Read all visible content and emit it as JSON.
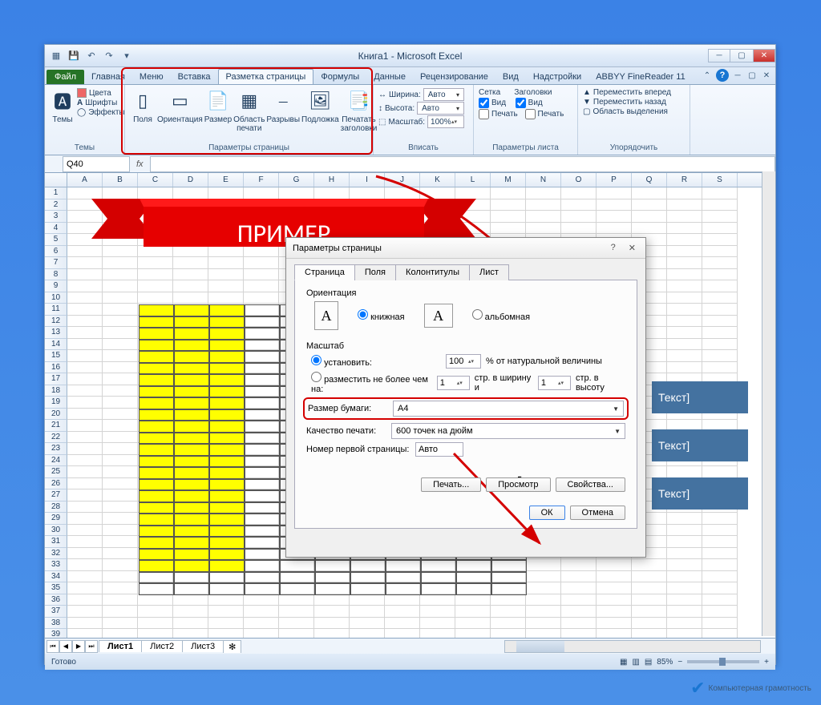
{
  "title": "Книга1 - Microsoft Excel",
  "file_tab": "Файл",
  "tabs": [
    "Главная",
    "Меню",
    "Вставка",
    "Разметка страницы",
    "Формулы",
    "Данные",
    "Рецензирование",
    "Вид",
    "Надстройки",
    "ABBYY FineReader 11"
  ],
  "active_tab": 3,
  "ribbon": {
    "themes": {
      "label": "Темы",
      "btn": "Темы",
      "colors": "Цвета",
      "fonts": "Шрифты",
      "effects": "Эффекты"
    },
    "page": {
      "label": "Параметры страницы",
      "margins": "Поля",
      "orient": "Ориентация",
      "size": "Размер",
      "area": "Область печати",
      "breaks": "Разрывы",
      "bg": "Подложка",
      "titles": "Печатать заголовки"
    },
    "fit": {
      "label": "Вписать",
      "width": "Ширина:",
      "height": "Высота:",
      "scale": "Масштаб:",
      "auto": "Авто",
      "pct": "100%"
    },
    "sheet": {
      "label": "Параметры листа",
      "grid": "Сетка",
      "head": "Заголовки",
      "view": "Вид",
      "print": "Печать"
    },
    "arrange": {
      "label": "Упорядочить",
      "fwd": "Переместить вперед",
      "back": "Переместить назад",
      "sel": "Область выделения"
    }
  },
  "namebox": "Q40",
  "cols": [
    "A",
    "B",
    "C",
    "D",
    "E",
    "F",
    "G",
    "H",
    "I",
    "J",
    "K",
    "L",
    "M",
    "N",
    "O",
    "P",
    "Q",
    "R",
    "S"
  ],
  "banner": "ПРИМЕР",
  "textbox": "Текст]",
  "dialog": {
    "title": "Параметры страницы",
    "tabs": [
      "Страница",
      "Поля",
      "Колонтитулы",
      "Лист"
    ],
    "orient_label": "Ориентация",
    "portrait": "книжная",
    "landscape": "альбомная",
    "scale_label": "Масштаб",
    "set": "установить:",
    "set_val": "100",
    "set_suffix": "% от натуральной величины",
    "fit": "разместить не более чем на:",
    "fit_w": "1",
    "fit_h": "1",
    "fit_mid": "стр. в ширину и",
    "fit_end": "стр. в высоту",
    "paper": "Размер бумаги:",
    "paper_val": "A4",
    "quality": "Качество печати:",
    "quality_val": "600 точек на дюйм",
    "firstpage": "Номер первой страницы:",
    "firstpage_val": "Авто",
    "print": "Печать...",
    "preview": "Просмотр",
    "props": "Свойства...",
    "ok": "ОК",
    "cancel": "Отмена"
  },
  "sheets": [
    "Лист1",
    "Лист2",
    "Лист3"
  ],
  "status": {
    "ready": "Готово",
    "zoom": "85%"
  },
  "watermark": "Компьютерная грамотность"
}
